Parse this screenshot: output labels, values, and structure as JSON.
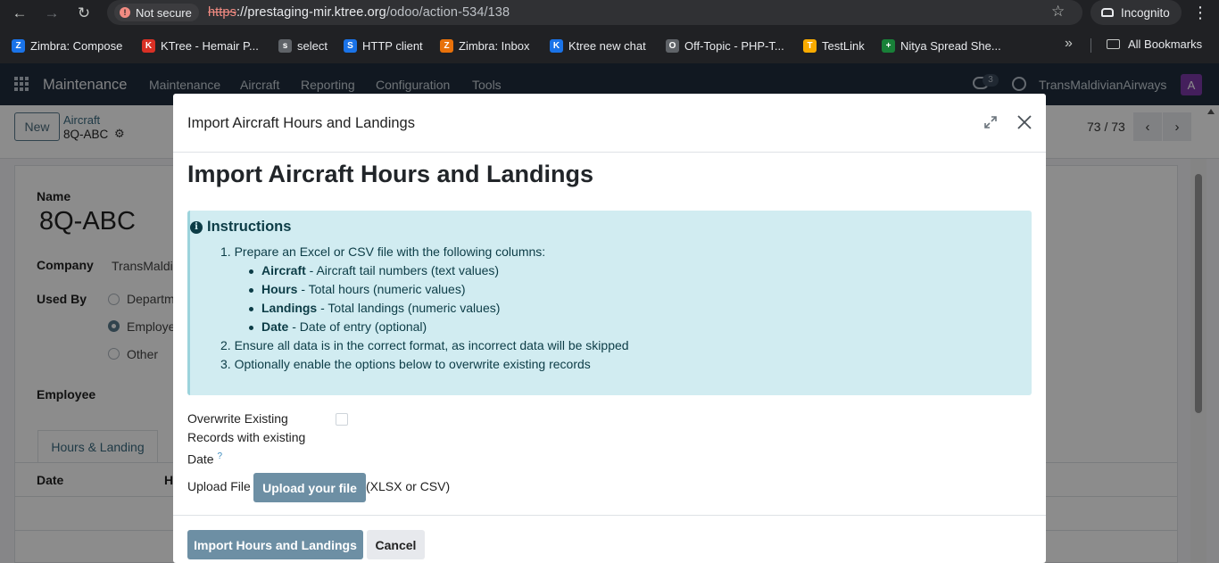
{
  "browser": {
    "not_secure": "Not secure",
    "url_scheme": "https",
    "url_host": "://prestaging-mir.ktree.org",
    "url_path": "/odoo/action-534/138",
    "incognito": "Incognito",
    "bookmarks": [
      {
        "label": "Zimbra: Compose",
        "icon_color": "#1a73e8",
        "glyph": "Z"
      },
      {
        "label": "KTree - Hemair P...",
        "icon_color": "#d93025",
        "glyph": "K"
      },
      {
        "label": "select",
        "icon_color": "#5f6368",
        "glyph": "s"
      },
      {
        "label": "HTTP client",
        "icon_color": "#1a73e8",
        "glyph": "S"
      },
      {
        "label": "Zimbra: Inbox",
        "icon_color": "#e8710a",
        "glyph": "Z"
      },
      {
        "label": "Ktree new chat",
        "icon_color": "#1a73e8",
        "glyph": "K"
      },
      {
        "label": "Off-Topic - PHP-T...",
        "icon_color": "#5f6368",
        "glyph": "O"
      },
      {
        "label": "TestLink",
        "icon_color": "#f9ab00",
        "glyph": "T"
      },
      {
        "label": "Nitya Spread She...",
        "icon_color": "#188038",
        "glyph": "+"
      }
    ],
    "more": "»",
    "all_bookmarks": "All Bookmarks"
  },
  "navbar": {
    "brand": "Maintenance",
    "menu": [
      "Maintenance",
      "Aircraft",
      "Reporting",
      "Configuration",
      "Tools"
    ],
    "chat_count": "3",
    "company": "TransMaldivianAirways",
    "avatar": "A"
  },
  "control": {
    "new": "New",
    "breadcrumb_parent": "Aircraft",
    "breadcrumb_record": "8Q-ABC",
    "pager": "73 / 73"
  },
  "form": {
    "name_label": "Name",
    "name_value": "8Q-ABC",
    "company_label": "Company",
    "company_value": "TransMaldi",
    "used_by_label": "Used By",
    "used_by_options": [
      "Departm",
      "Employe",
      "Other"
    ],
    "employee_label": "Employee",
    "tab": "Hours & Landing",
    "col_date": "Date",
    "col_h": "H"
  },
  "modal": {
    "title": "Import Aircraft Hours and Landings",
    "heading": "Import Aircraft Hours and Landings",
    "instructions_title": "Instructions",
    "step1": "1. Prepare an Excel or CSV file with the following columns:",
    "columns": [
      {
        "name": "Aircraft",
        "desc": " - Aircraft tail numbers (text values)"
      },
      {
        "name": "Hours",
        "desc": " - Total hours (numeric values)"
      },
      {
        "name": "Landings",
        "desc": " - Total landings (numeric values)"
      },
      {
        "name": "Date",
        "desc": " - Date of entry (optional)"
      }
    ],
    "step2": "2. Ensure all data is in the correct format, as incorrect data will be skipped",
    "step3": "3. Optionally enable the options below to overwrite existing records",
    "overwrite_label": "Overwrite Existing Records with existing Date",
    "overwrite_help": "?",
    "upload_label": "Upload File",
    "upload_button": "Upload your file",
    "upload_hint": "(XLSX or CSV)",
    "import_button": "Import Hours and Landings",
    "cancel_button": "Cancel"
  }
}
